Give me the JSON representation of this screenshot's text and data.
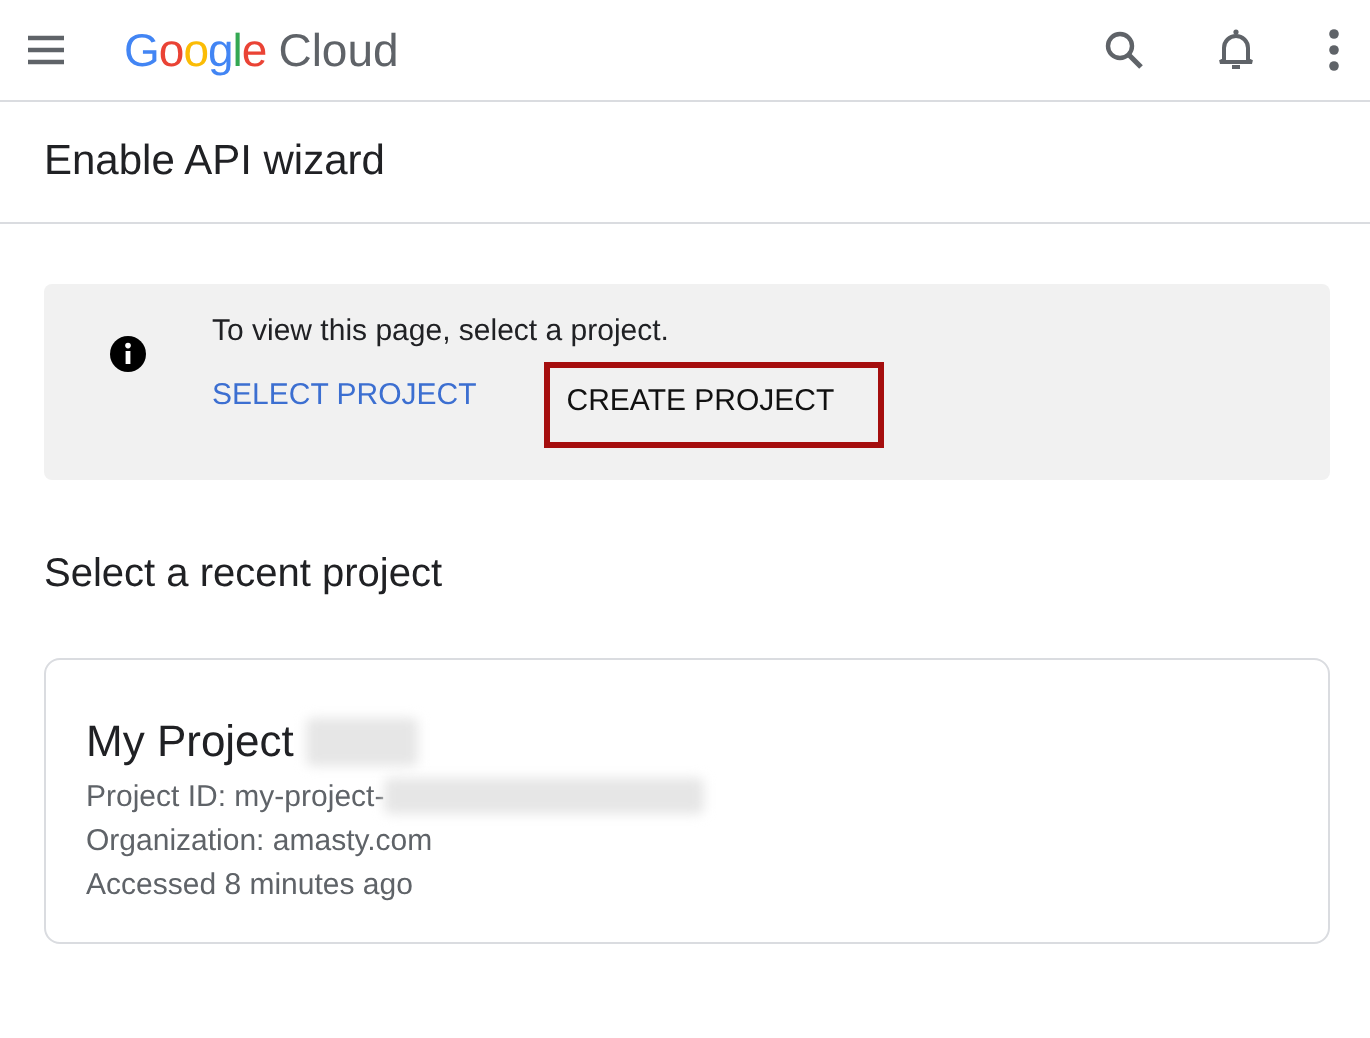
{
  "header": {
    "logo": {
      "brand": "Google",
      "product": "Cloud"
    }
  },
  "page_title": "Enable API wizard",
  "notice": {
    "message": "To view this page, select a project.",
    "actions": [
      {
        "label": "SELECT PROJECT",
        "kind": "link",
        "highlighted": false
      },
      {
        "label": "CREATE PROJECT",
        "kind": "plain",
        "highlighted": true
      }
    ]
  },
  "recent_heading": "Select a recent project",
  "projects": [
    {
      "name": "My Project",
      "name_redacted": true,
      "id_label": "Project ID: my-project-",
      "id_redacted": true,
      "organization": "Organization: amasty.com",
      "accessed": "Accessed 8 minutes ago"
    }
  ]
}
